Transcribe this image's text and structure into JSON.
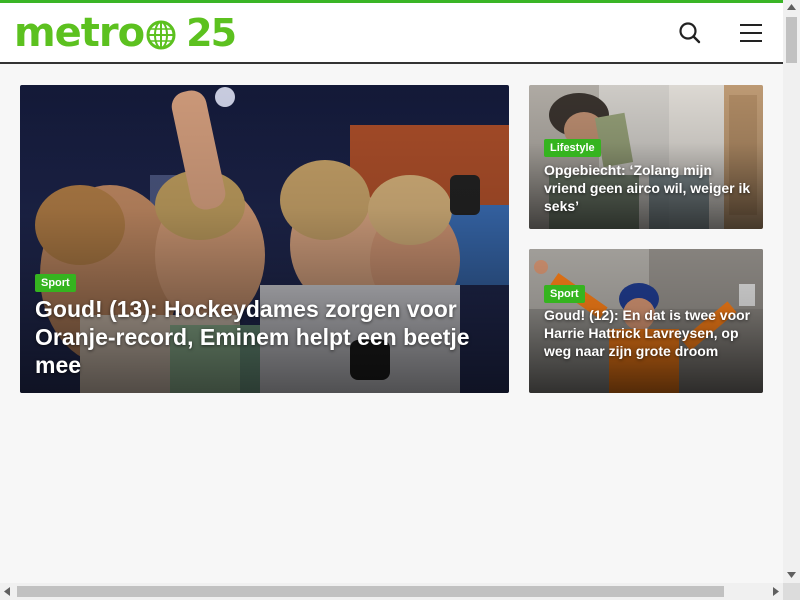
{
  "brand": {
    "logo_text": "metro",
    "logo_number": "25",
    "accent_color": "#5cc11f",
    "tag_color": "#35b41f"
  },
  "header": {
    "search_icon": "search-icon",
    "menu_icon": "hamburger-menu-icon"
  },
  "articles": {
    "main": {
      "category": "Sport",
      "title": "Goud! (13): Hockeydames zorgen voor Oranje-record, Eminem helpt een beetje mee"
    },
    "side1": {
      "category": "Lifestyle",
      "title": "Opgebiecht: ‘Zolang mijn vriend geen airco wil, weiger ik seks’"
    },
    "side2": {
      "category": "Sport",
      "title": "Goud! (12): En dat is twee voor Harrie Hattrick Lavreysen, op weg naar zijn grote droom"
    }
  }
}
